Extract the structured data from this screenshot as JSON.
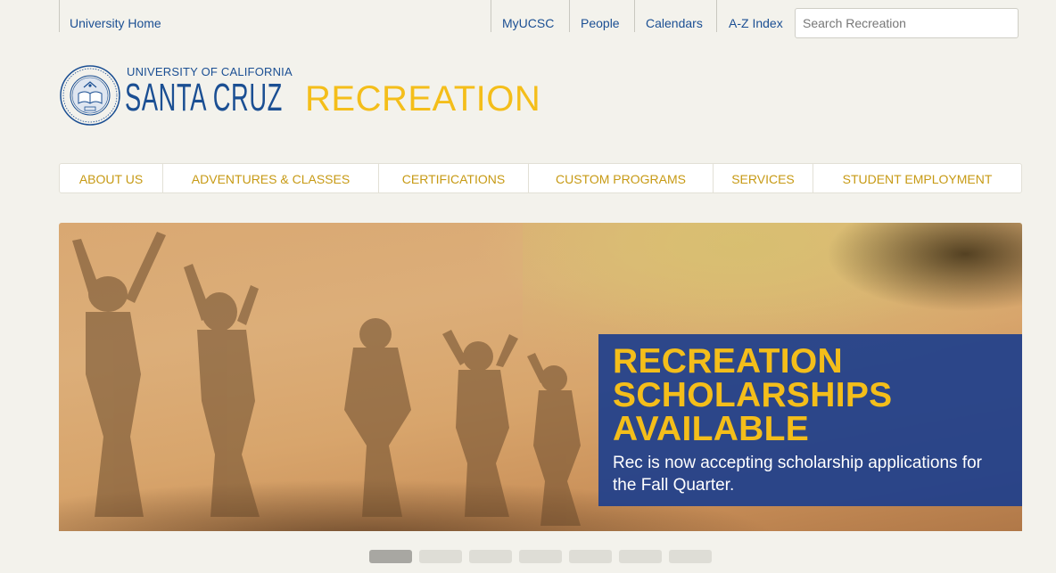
{
  "topbar": {
    "home": "University Home",
    "links": [
      "MyUCSC",
      "People",
      "Calendars",
      "A-Z Index"
    ],
    "search_placeholder": "Search Recreation"
  },
  "logo": {
    "line1": "UNIVERSITY OF CALIFORNIA",
    "line2": "SANTA CRUZ",
    "dept": "RECREATION"
  },
  "nav": {
    "items": [
      "ABOUT US",
      "ADVENTURES & CLASSES",
      "CERTIFICATIONS",
      "CUSTOM PROGRAMS",
      "SERVICES",
      "STUDENT EMPLOYMENT"
    ]
  },
  "hero": {
    "title": "RECREATION SCHOLARSHIPS AVAILABLE",
    "text": "Rec is now accepting scholarship applications for the Fall Quarter."
  },
  "slider": {
    "count": 7,
    "active_index": 0
  },
  "colors": {
    "accent": "#f4be1a",
    "brand_blue": "#1b4f93",
    "caption_bg": "#1f3f8c"
  }
}
